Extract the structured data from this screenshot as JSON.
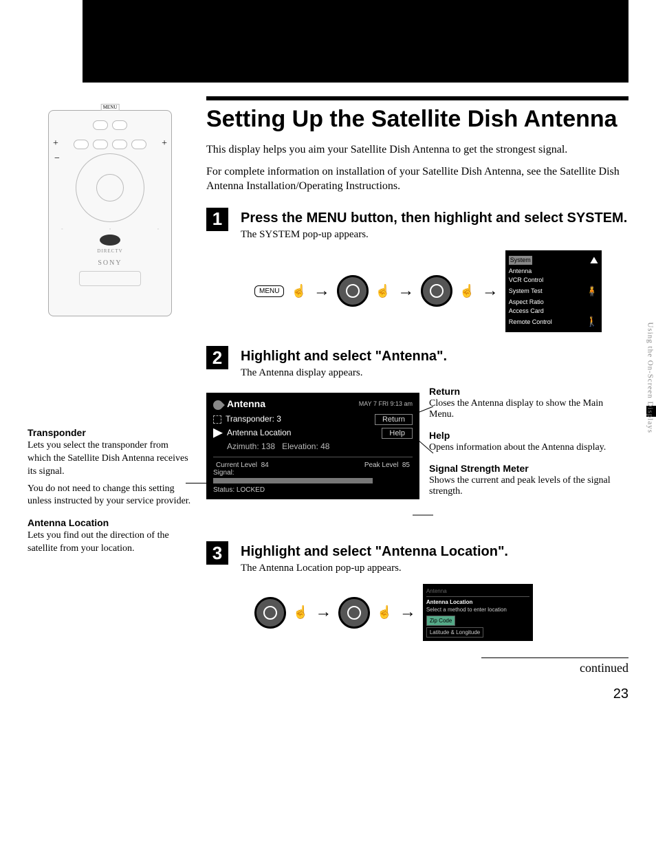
{
  "page_number": "23",
  "continued": "continued",
  "title": "Setting Up the Satellite Dish Antenna",
  "intro1": "This display helps you aim your Satellite Dish Antenna to get the strongest signal.",
  "intro2": "For complete information on installation of your Satellite Dish Antenna, see the Satellite Dish Antenna Installation/Operating Instructions.",
  "remote": {
    "brand": "SONY",
    "directv": "DIRECTV",
    "menu": "MENU"
  },
  "steps": {
    "s1": {
      "num": "1",
      "title": "Press the MENU button, then highlight and select SYSTEM.",
      "sub": "The SYSTEM pop-up appears.",
      "menu_label": "MENU",
      "popup": {
        "title_hl": "System",
        "items": [
          "Antenna",
          "VCR Control",
          "System Test",
          "Aspect Ratio",
          "Access Card",
          "Remote Control"
        ]
      }
    },
    "s2": {
      "num": "2",
      "title": "Highlight and select \"Antenna\".",
      "sub": "The Antenna display appears."
    },
    "s3": {
      "num": "3",
      "title": "Highlight and select \"Antenna Location\".",
      "sub": "The Antenna Location pop-up appears.",
      "popup": {
        "header": "Antenna",
        "section": "Antenna Location",
        "prompt": "Select a method to enter location",
        "opt1": "Zip Code",
        "opt2": "Latitude & Longitude"
      }
    }
  },
  "defs": {
    "transponder": {
      "t": "Transponder",
      "p1": "Lets you select the transponder from which the Satellite Dish Antenna receives its signal.",
      "p2": "You do not need to change this setting unless instructed by your service provider."
    },
    "antloc": {
      "t": "Antenna Location",
      "p": "Lets you find out the direction of the satellite from your location."
    }
  },
  "screen": {
    "title": "Antenna",
    "datetime": "MAY  7 FRI  9:13 am",
    "transponder_label": "Transponder:",
    "transponder_val": "3",
    "antloc_label": "Antenna Location",
    "azimuth_label": "Azimuth:",
    "azimuth_val": "138",
    "elevation_label": "Elevation:",
    "elevation_val": "48",
    "return_btn": "Return",
    "help_btn": "Help",
    "cur_label": "Current Level",
    "cur_val": "84",
    "peak_label": "Peak Level",
    "peak_val": "85",
    "signal_label": "Signal:",
    "status_label": "Status:",
    "status_val": "LOCKED"
  },
  "callouts": {
    "ret": {
      "t": "Return",
      "p": "Closes the Antenna display to show the Main Menu."
    },
    "help": {
      "t": "Help",
      "p": "Opens information about the Antenna display."
    },
    "meter": {
      "t": "Signal Strength Meter",
      "p": "Shows the current and peak levels of the signal strength."
    }
  },
  "side_text": "Using the On-Screen Displays"
}
